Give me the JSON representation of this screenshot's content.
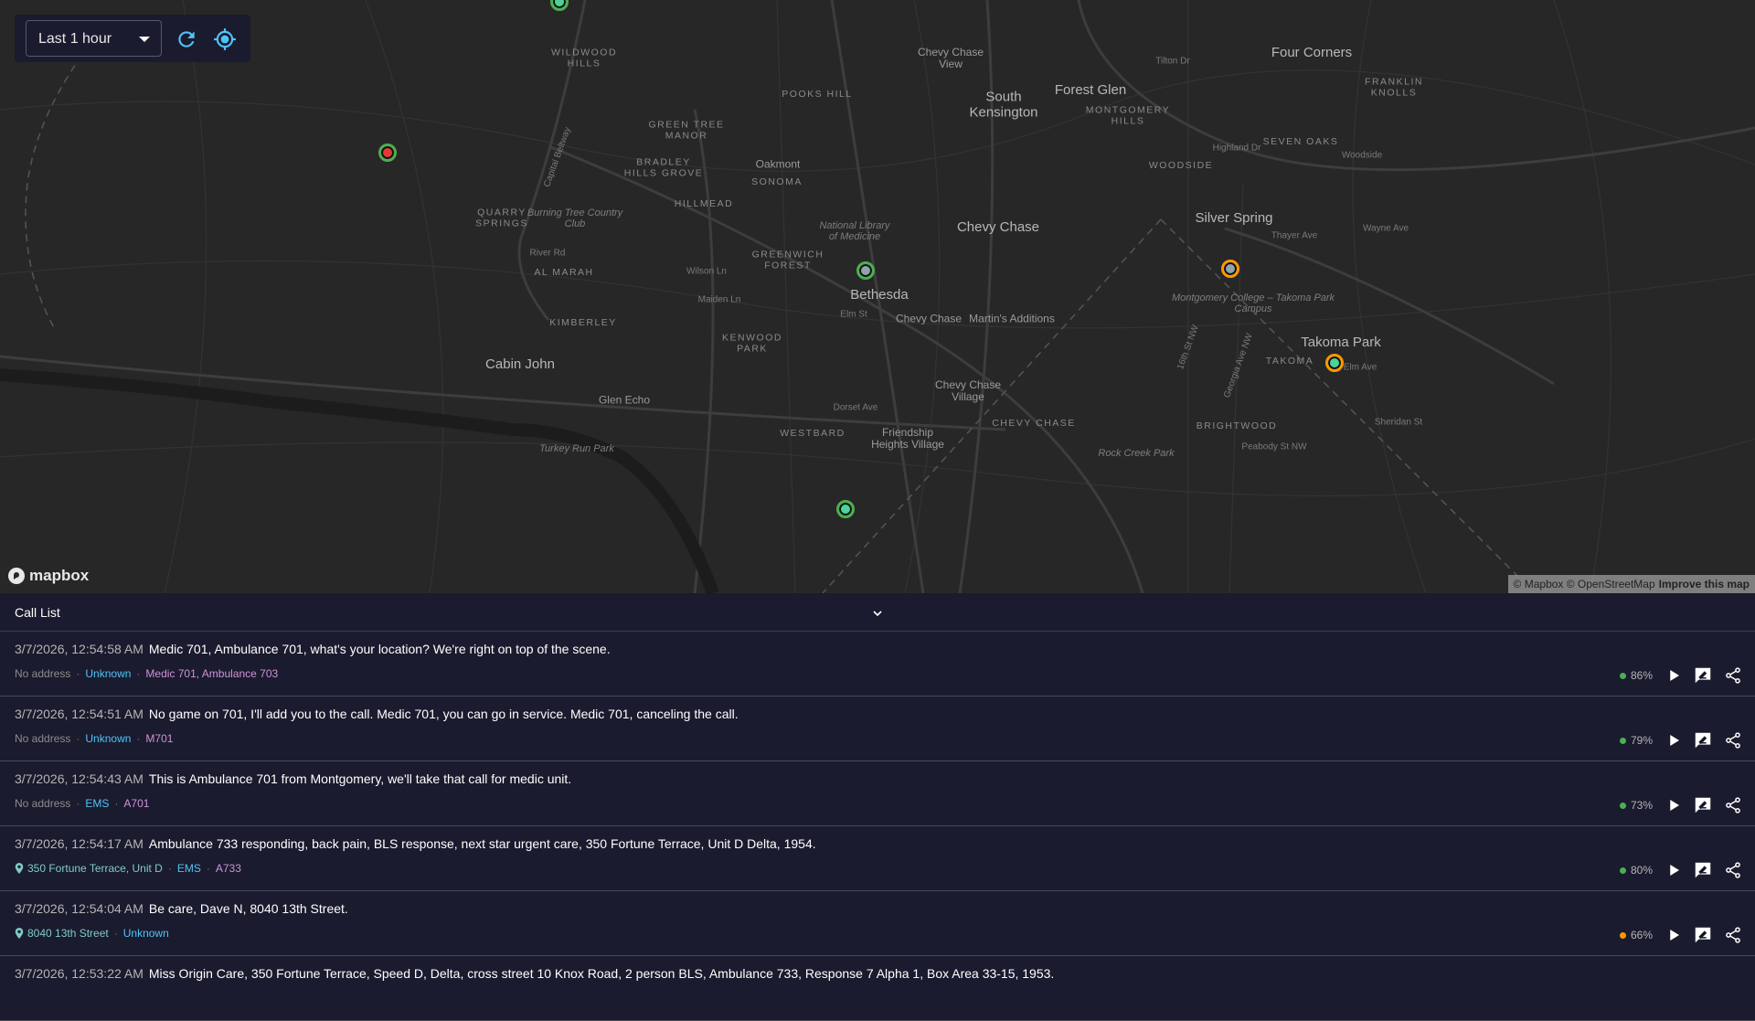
{
  "controls": {
    "time_range": "Last 1 hour",
    "refresh_icon": "refresh-icon",
    "locate_icon": "my-location-icon",
    "accent": "#4fc3f7"
  },
  "map": {
    "labels": [
      "WILDWOOD HILLS",
      "Chevy Chase View",
      "Four Corners",
      "Tilton Dr",
      "POOKS HILL",
      "South Kensington",
      "Forest Glen",
      "MONTGOMERY HILLS",
      "FRANKLIN KNOLLS",
      "GREEN TREE MANOR",
      "Capital Beltway",
      "Oakmont",
      "SONOMA",
      "BRADLEY HILLS GROVE",
      "HILLMEAD",
      "SEVEN OAKS",
      "WOODSIDE",
      "Highland Dr",
      "QUARRY SPRINGS",
      "Burning Tree Country Club",
      "National Library of Medicine",
      "Chevy Chase",
      "Silver Spring",
      "Thayer Ave",
      "GREENWICH FOREST",
      "Bethesda",
      "Elm St",
      "Chevy Chase",
      "Martin's Additions",
      "Montgomery College – Takoma Park Campus",
      "Takoma Park",
      "TAKOMA",
      "KIMBERLEY",
      "KENWOOD PARK",
      "Cabin John",
      "Glen Echo",
      "Chevy Chase Village",
      "CHEVY CHASE",
      "Dorset Ave",
      "WESTBARD",
      "Friendship Heights Village",
      "BRIGHTWOOD",
      "Peabody St NW",
      "Rock Creek Park",
      "Turkey Run Park",
      "AL MARAH",
      "River Rd",
      "Wilson Ln",
      "Maiden Ln",
      "16th St NW",
      "Georgia Ave NW",
      "Elm Ave",
      "Sheridan St",
      "Wayne Ave",
      "Woodside"
    ],
    "markers": [
      {
        "fill": "#4cd39b",
        "ring": "#4caf50"
      },
      {
        "fill": "#e53935",
        "ring": "#4caf50"
      },
      {
        "fill": "#90a4ae",
        "ring": "#4caf50"
      },
      {
        "fill": "#90a4ae",
        "ring": "#ff9800"
      },
      {
        "fill": "#4cd39b",
        "ring": "#ff9800"
      },
      {
        "fill": "#4cd39b",
        "ring": "#4caf50"
      }
    ],
    "logo": "mapbox",
    "attribution": "© Mapbox © OpenStreetMap",
    "improve": "Improve this map"
  },
  "call_list": {
    "title": "Call List",
    "rows": [
      {
        "time": "3/7/2026, 12:54:58 AM",
        "message": "Medic 701, Ambulance 701, what's your location? We're right on top of the scene.",
        "address": "No address",
        "has_address": false,
        "type": "Unknown",
        "units": "Medic 701, Ambulance 703",
        "confidence": "86%",
        "conf_color": "#4caf50"
      },
      {
        "time": "3/7/2026, 12:54:51 AM",
        "message": "No game on 701, I'll add you to the call. Medic 701, you can go in service. Medic 701, canceling the call.",
        "address": "No address",
        "has_address": false,
        "type": "Unknown",
        "units": "M701",
        "confidence": "79%",
        "conf_color": "#4caf50"
      },
      {
        "time": "3/7/2026, 12:54:43 AM",
        "message": "This is Ambulance 701 from Montgomery, we'll take that call for medic unit.",
        "address": "No address",
        "has_address": false,
        "type": "EMS",
        "units": "A701",
        "confidence": "73%",
        "conf_color": "#4caf50"
      },
      {
        "time": "3/7/2026, 12:54:17 AM",
        "message": "Ambulance 733 responding, back pain, BLS response, next star urgent care, 350 Fortune Terrace, Unit D Delta, 1954.",
        "address": "350 Fortune Terrace, Unit D",
        "has_address": true,
        "type": "EMS",
        "units": "A733",
        "confidence": "80%",
        "conf_color": "#4caf50"
      },
      {
        "time": "3/7/2026, 12:54:04 AM",
        "message": "Be care, Dave N, 8040 13th Street.",
        "address": "8040 13th Street",
        "has_address": true,
        "type": "Unknown",
        "units": "",
        "confidence": "66%",
        "conf_color": "#ff9800"
      },
      {
        "time": "3/7/2026, 12:53:22 AM",
        "message": "Miss Origin Care, 350 Fortune Terrace, Speed D, Delta, cross street 10 Knox Road, 2 person BLS, Ambulance 733, Response 7 Alpha 1, Box Area 33-15, 1953."
      }
    ]
  }
}
